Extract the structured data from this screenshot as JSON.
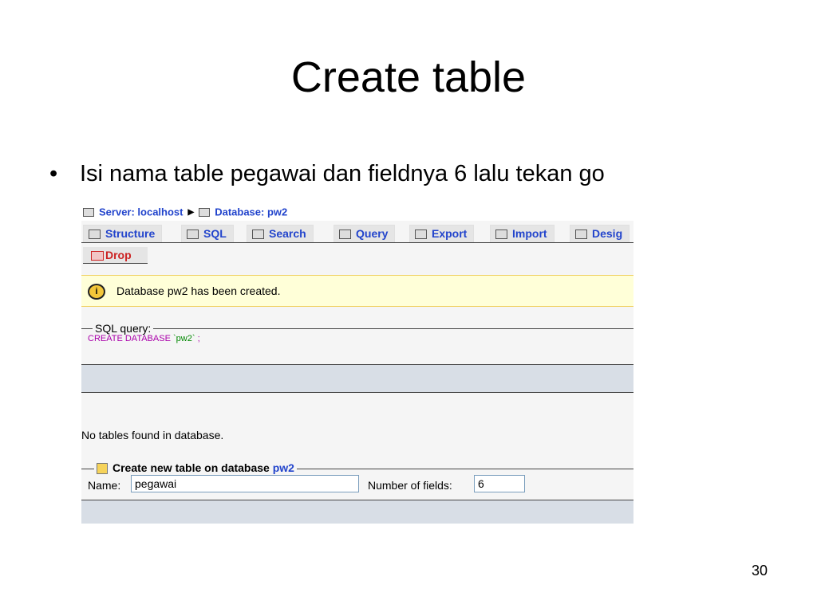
{
  "slide": {
    "title": "Create table",
    "bullet": "Isi nama table pegawai dan fieldnya  6 lalu  tekan go",
    "page_number": "30"
  },
  "breadcrumb": {
    "server_label": "Server: localhost",
    "database_label": "Database: pw2"
  },
  "tabs": [
    {
      "label": "Structure",
      "icon": "structure-icon"
    },
    {
      "label": "SQL",
      "icon": "sql-icon"
    },
    {
      "label": "Search",
      "icon": "search-icon"
    },
    {
      "label": "Query",
      "icon": "query-icon"
    },
    {
      "label": "Export",
      "icon": "export-icon"
    },
    {
      "label": "Import",
      "icon": "import-icon"
    },
    {
      "label": "Desig",
      "icon": "designer-icon"
    }
  ],
  "drop_tab": {
    "label": "Drop",
    "icon": "drop-icon"
  },
  "notice": {
    "message": "Database pw2 has been created.",
    "icon": "info-icon"
  },
  "sql_query": {
    "legend": "SQL query:",
    "keyword": "CREATE DATABASE",
    "string": "`pw2`",
    "terminator": ";"
  },
  "no_tables": "No tables found in database.",
  "create_table": {
    "legend_prefix": "Create new table on database",
    "database": "pw2",
    "name_label": "Name:",
    "name_value": "pegawai",
    "fields_label": "Number of fields:",
    "fields_value": "6"
  },
  "colors": {
    "link": "#2244cc",
    "drop": "#cc2222",
    "notice_bg": "#ffffd8",
    "sql_keyword": "#aa00aa"
  }
}
